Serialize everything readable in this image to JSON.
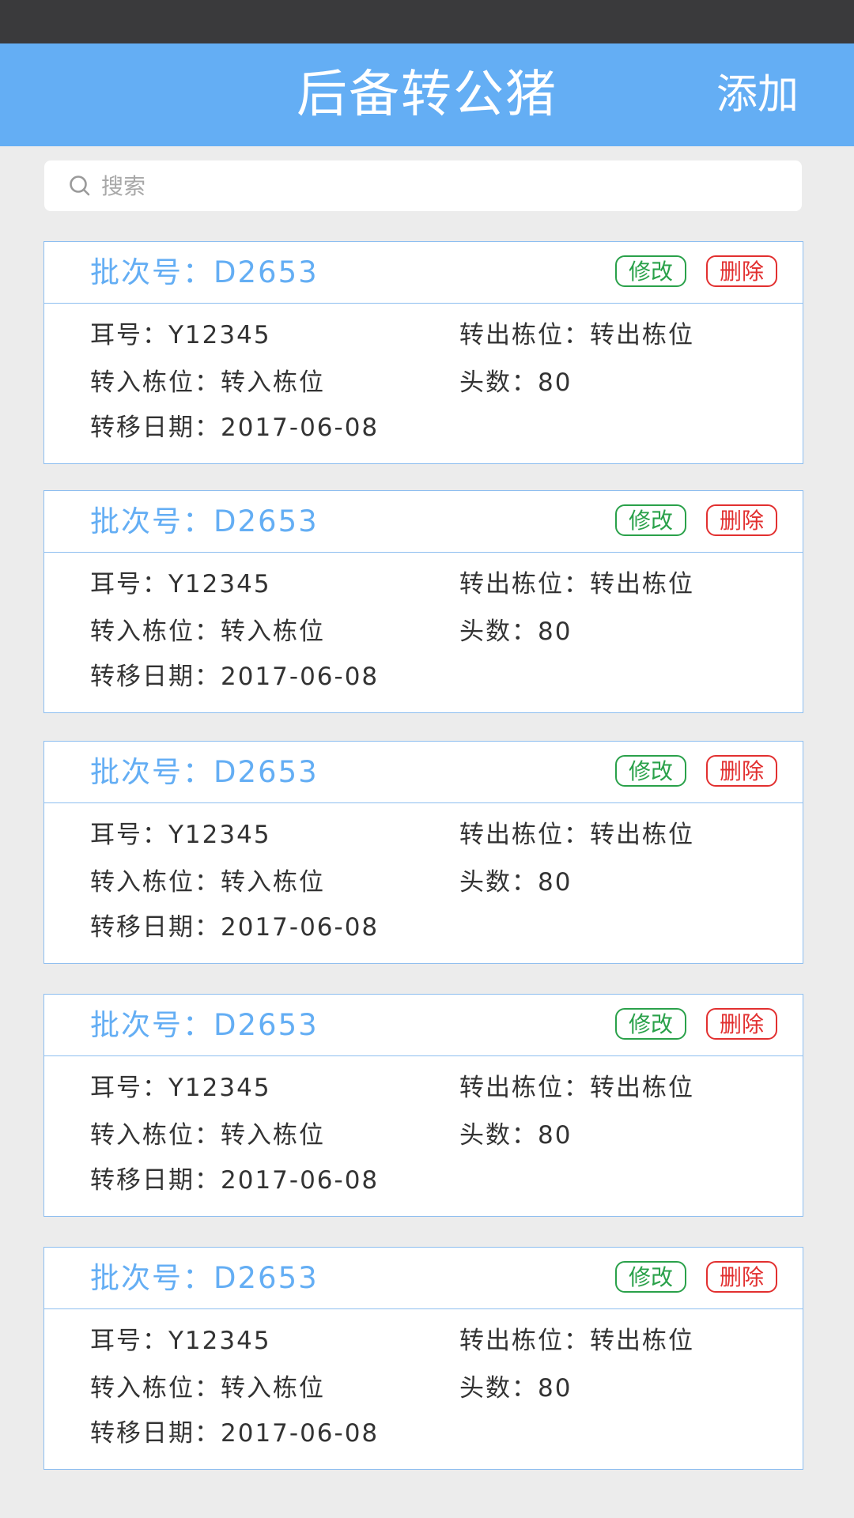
{
  "header": {
    "title": "后备转公猪",
    "add_label": "添加"
  },
  "search": {
    "placeholder": "搜索"
  },
  "labels": {
    "batch": "批次号：",
    "ear": "耳号：",
    "out_pen": "转出栋位：",
    "in_pen": "转入栋位：",
    "head_count": "头数：",
    "date": "转移日期："
  },
  "buttons": {
    "edit": "修改",
    "delete": "删除"
  },
  "records": [
    {
      "batch_value": "D2653",
      "ear_value": "Y12345",
      "out_pen_value": "转出栋位",
      "in_pen_value": "转入栋位",
      "head_count_value": "80",
      "date_value": "2017-06-08"
    },
    {
      "batch_value": "D2653",
      "ear_value": "Y12345",
      "out_pen_value": "转出栋位",
      "in_pen_value": "转入栋位",
      "head_count_value": "80",
      "date_value": "2017-06-08"
    },
    {
      "batch_value": "D2653",
      "ear_value": "Y12345",
      "out_pen_value": "转出栋位",
      "in_pen_value": "转入栋位",
      "head_count_value": "80",
      "date_value": "2017-06-08"
    },
    {
      "batch_value": "D2653",
      "ear_value": "Y12345",
      "out_pen_value": "转出栋位",
      "in_pen_value": "转入栋位",
      "head_count_value": "80",
      "date_value": "2017-06-08"
    },
    {
      "batch_value": "D2653",
      "ear_value": "Y12345",
      "out_pen_value": "转出栋位",
      "in_pen_value": "转入栋位",
      "head_count_value": "80",
      "date_value": "2017-06-08"
    }
  ]
}
